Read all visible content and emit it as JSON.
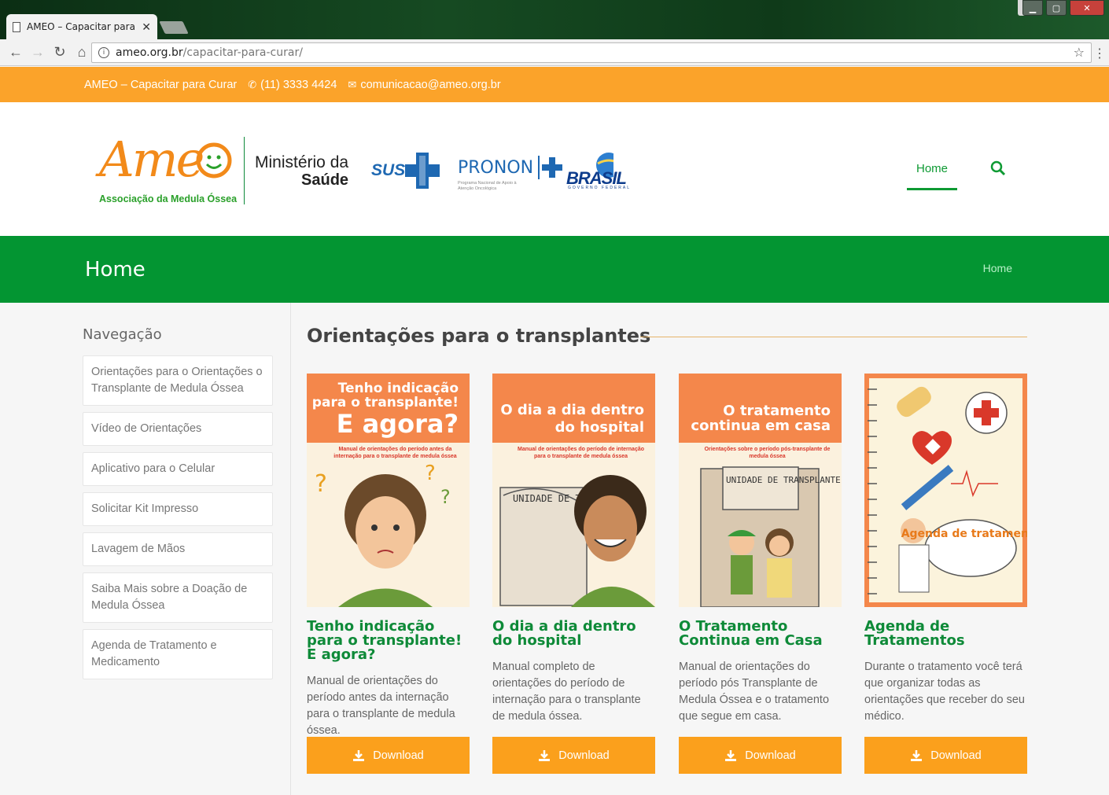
{
  "browser": {
    "tab_title": "AMEO – Capacitar para C",
    "tab_close": "✕",
    "url_host": "ameo.org.br",
    "url_path": "/capacitar-para-curar/"
  },
  "topbar": {
    "site_name": "AMEO – Capacitar para Curar",
    "phone": "(11) 3333 4424",
    "email": "comunicacao@ameo.org.br"
  },
  "header": {
    "logo_word": "Ame",
    "logo_subtitle": "Associação da Medula Óssea",
    "ministerio_line1": "Ministério da",
    "ministerio_line2": "Saúde",
    "sus": "SUS",
    "pronon": "PRONON",
    "pronon_sub": "Programa Nacional de Apoio à Atenção Oncológica",
    "brasil": "BRASIL",
    "brasil_sub": "GOVERNO FEDERAL",
    "nav_home": "Home"
  },
  "band": {
    "title": "Home",
    "breadcrumb": "Home"
  },
  "sidebar": {
    "title": "Navegação",
    "items": [
      {
        "label": "Orientações para o Orientações o Transplante de Medula Óssea"
      },
      {
        "label": "Vídeo de Orientações"
      },
      {
        "label": "Aplicativo para o Celular"
      },
      {
        "label": "Solicitar Kit Impresso"
      },
      {
        "label": "Lavagem de Mãos"
      },
      {
        "label": "Saiba Mais sobre a Doação de Medula Óssea"
      },
      {
        "label": "Agenda de Tratamento e Medicamento"
      }
    ]
  },
  "main": {
    "title": "Orientações para o transplantes",
    "download_label": "Download",
    "cards": [
      {
        "cover_line1": "Tenho indicação",
        "cover_line2": "para o transplante!",
        "cover_line3": "E agora?",
        "cover_sub": "Manual de orientações do período antes da internação para o transplante de medula óssea",
        "title": "Tenho indicação para o transplante! E agora?",
        "desc": "Manual de orientações do período antes da internação para o transplante de medula óssea."
      },
      {
        "cover_line1": "O dia a dia dentro",
        "cover_line2": "do hospital",
        "cover_sub": "Manual de orientações do período de internação para o transplante de medula óssea",
        "cover_sign": "UNIDADE DE TRANSPLANTE",
        "title": "O dia a dia dentro do hospital",
        "desc": "Manual completo de orientações do período de internação para o transplante de medula óssea."
      },
      {
        "cover_line1": "O tratamento",
        "cover_line2": "continua em casa",
        "cover_sub": "Orientações sobre o período pós-transplante de medula óssea",
        "cover_sign": "UNIDADE DE TRANSPLANTE",
        "title": "O Tratamento Continua em Casa",
        "desc": "Manual de orientações do período pós Transplante de Medula Óssea e o tratamento que segue em casa."
      },
      {
        "cover_text": "Agenda de tratamento",
        "title": "Agenda de Tratamentos",
        "desc": "Durante o tratamento você terá que organizar todas as orientações que receber do seu médico."
      }
    ]
  },
  "colors": {
    "orange": "#fba32a",
    "green": "#039532",
    "title_green": "#0e8a38"
  }
}
